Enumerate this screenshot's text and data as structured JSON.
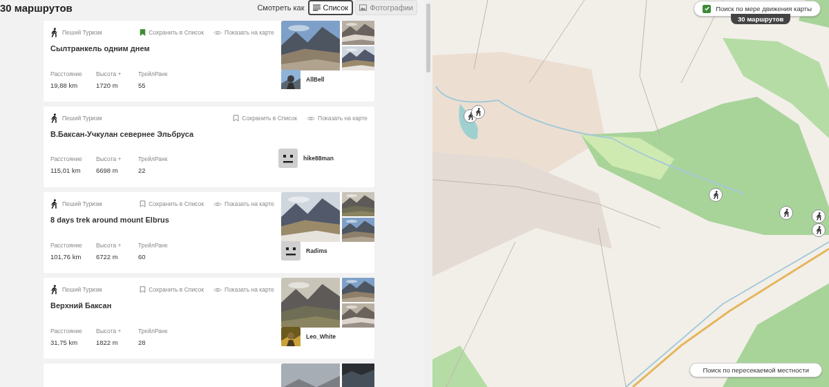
{
  "header": {
    "count": "30 маршрутов",
    "view_label": "Смотреть как",
    "views": [
      {
        "label": "Список",
        "kind": "list",
        "selected": true
      },
      {
        "label": "Фотографии",
        "kind": "photos",
        "selected": false
      }
    ]
  },
  "routes": [
    {
      "kind": "full",
      "activity": "Пеший Туризм",
      "save": "Сохранить в Список",
      "saved": true,
      "show": "Показать на карте",
      "title": "Сылтранкель одним днем",
      "stats": [
        {
          "label": "Расстояние",
          "value": "19,88 km"
        },
        {
          "label": "Высота +",
          "value": "1720 m"
        },
        {
          "label": "ТрейлРанк",
          "value": "55"
        }
      ],
      "photos": true,
      "author": "AllBell"
    },
    {
      "kind": "full",
      "activity": "Пеший Туризм",
      "save": "Сохранить в Список",
      "saved": false,
      "show": "Показать на карте",
      "title": "В.Баксан-Учкулан севернее Эльбруса",
      "stats": [
        {
          "label": "Расстояние",
          "value": "115,01 km"
        },
        {
          "label": "Высота +",
          "value": "6698 m"
        },
        {
          "label": "ТрейлРанк",
          "value": "22"
        }
      ],
      "photos": false,
      "avatar": {
        "kind": "default"
      },
      "author": "hike88man"
    },
    {
      "kind": "full",
      "activity": "Пеший Туризм",
      "save": "Сохранить в Список",
      "saved": false,
      "show": "Показать на карте",
      "title": "8 days trek around mount Elbrus",
      "stats": [
        {
          "label": "Расстояние",
          "value": "101,76 km"
        },
        {
          "label": "Высота +",
          "value": "6722 m"
        },
        {
          "label": "ТрейлРанк",
          "value": "60"
        }
      ],
      "photos": true,
      "avatar": {
        "kind": "default"
      },
      "author": "Radims"
    },
    {
      "kind": "full",
      "activity": "Пеший Туризм",
      "save": "Сохранить в Список",
      "saved": false,
      "show": "Показать на карте",
      "title": "Верхний Баксан",
      "stats": [
        {
          "label": "Расстояние",
          "value": "31,75 km"
        },
        {
          "label": "Высота +",
          "value": "1822 m"
        },
        {
          "label": "ТрейлРанк",
          "value": "28"
        }
      ],
      "photos": true,
      "author": "Leo_White"
    },
    {
      "kind": "cut",
      "photos": true
    }
  ],
  "map": {
    "kind": "picture",
    "move_search": {
      "label": "Поиск по мере движения карты",
      "checked": true
    },
    "count_badge": "30 маршрутов",
    "terrain_search": "Поиск по пересекаемой местности"
  }
}
